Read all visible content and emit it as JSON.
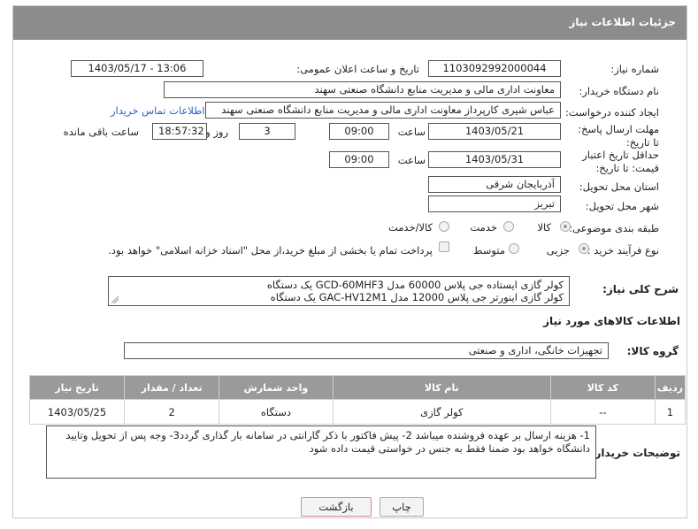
{
  "header": {
    "title": "جزئیات اطلاعات نیاز"
  },
  "fields": {
    "need_number_label": "شماره نیاز:",
    "need_number": "1103092992000044",
    "announce_label": "تاریخ و ساعت اعلان عمومی:",
    "announce_value": "1403/05/17 - 13:06",
    "buyer_label": "نام دستگاه خریدار:",
    "buyer_value": "معاونت اداری  مالی و مدیریت منابع دانشگاه صنعتی سهند",
    "creator_label": "ایجاد کننده درخواست:",
    "creator_value": "عباس شیری کارپرداز معاونت اداری  مالی و مدیریت منابع دانشگاه صنعتی سهند",
    "contact_link": "اطلاعات تماس خریدار",
    "deadline_label": "مهلت ارسال پاسخ: تا تاریخ:",
    "deadline_date": "1403/05/21",
    "time_label": "ساعت",
    "deadline_time": "09:00",
    "days_value": "3",
    "days_label": "روز و",
    "remaining_time": "18:57:32",
    "remaining_label": "ساعت باقی مانده",
    "validity_label": "حداقل تاریخ اعتبار قیمت: تا تاریخ:",
    "validity_date": "1403/05/31",
    "validity_time": "09:00",
    "province_label": "استان محل تحویل:",
    "province_value": "آذربایجان شرقی",
    "city_label": "شهر محل تحویل:",
    "city_value": "تبریز",
    "category_label": "طبقه بندی موضوعی:",
    "category_options": [
      "کالا",
      "خدمت",
      "کالا/خدمت"
    ],
    "process_label": "نوع فرآیند خرید :",
    "process_options": [
      "جزیی",
      "متوسط"
    ],
    "payment_note": "پرداخت تمام یا بخشی از مبلغ خرید،از محل \"اسناد خزانه اسلامی\" خواهد بود."
  },
  "description": {
    "label": "شرح کلی نیاز:",
    "line1": "کولر گازی ایستاده جی پلاس 60000  مدل  GCD-60MHF3 یک دستگاه",
    "line2": "کولر گازی اینورتر جی پلاس 12000 مدل GAC-HV12M1 یک دستگاه"
  },
  "goods": {
    "section_title": "اطلاعات کالاهای مورد نیاز",
    "group_label": "گروه کالا:",
    "group_value": "تجهیزات خانگی، اداری و صنعتی",
    "columns": [
      "ردیف",
      "کد کالا",
      "نام کالا",
      "واحد شمارش",
      "تعداد / مقدار",
      "تاریخ نیاز"
    ],
    "rows": [
      {
        "row": "1",
        "code": "--",
        "name": "کولر گازی",
        "unit": "دستگاه",
        "qty": "2",
        "date": "1403/05/25"
      }
    ]
  },
  "buyer_notes": {
    "label": "توضیحات خریدار:",
    "text": "1- هزینه ارسال بر عهده فروشنده میباشد 2- پیش فاکتور با ذکر گارانتی در سامانه بار گذاری گردد3- وجه پس از تحویل وتایید دانشگاه خواهد بود ضمنا فقط به جنس در خواستی قیمت داده شود"
  },
  "buttons": {
    "print": "چاپ",
    "back": "بازگشت"
  },
  "colors": {
    "header_bg": "#8c8c8c",
    "link": "#2a63c7",
    "back_border": "#d98a8a"
  }
}
